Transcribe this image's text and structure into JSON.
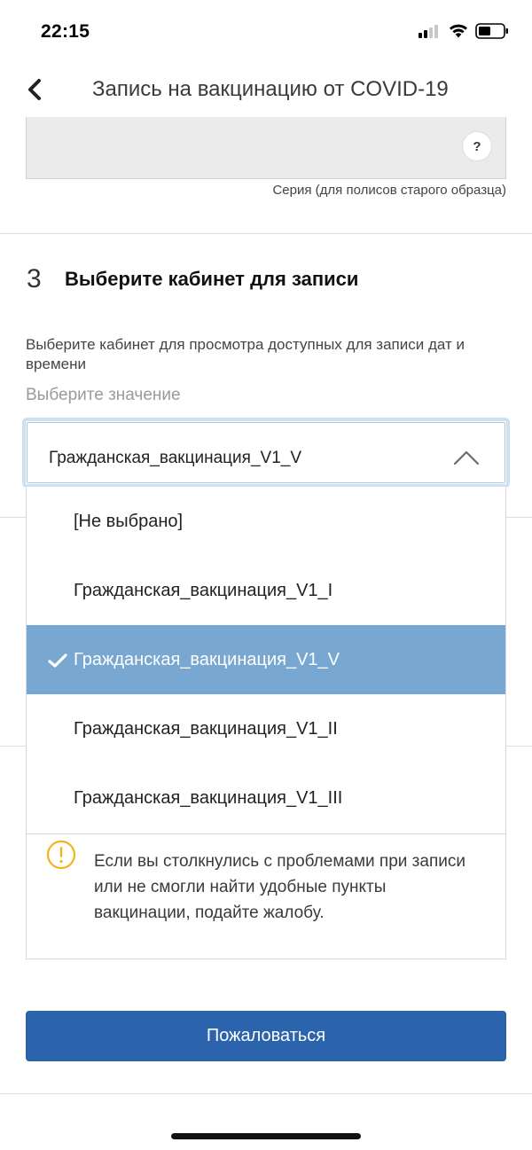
{
  "status_bar": {
    "time": "22:15",
    "icons": [
      "signal-icon",
      "wifi-icon",
      "battery-icon"
    ]
  },
  "header": {
    "back_icon": "chevron-left-icon",
    "title": "Запись на вакцинацию от COVID-19"
  },
  "series_field": {
    "value": "",
    "help_label": "?",
    "caption": "Серия (для полисов старого образца)"
  },
  "step3": {
    "number": "3",
    "title": "Выберите кабинет для записи",
    "description": "Выберите кабинет для просмотра доступных для записи дат и времени",
    "placeholder": "Выберите значение",
    "selected_value": "Гражданская_вакцинация_V1_V",
    "chevron_icon": "chevron-up-icon",
    "options": [
      {
        "label": "[Не выбрано]",
        "selected": false
      },
      {
        "label": "Гражданская_вакцинация_V1_I",
        "selected": false
      },
      {
        "label": "Гражданская_вакцинация_V1_V",
        "selected": true
      },
      {
        "label": "Гражданская_вакцинация_V1_II",
        "selected": false
      },
      {
        "label": "Гражданская_вакцинация_V1_III",
        "selected": false
      }
    ]
  },
  "info": {
    "icon": "warning-icon",
    "text": "Если вы столкнулись с проблемами при записи или не смогли найти удобные пункты вакцинации, подайте жалобу."
  },
  "complain_button": {
    "label": "Пожаловаться"
  },
  "colors": {
    "accent": "#2b63ac",
    "selected_option": "#78a8d1",
    "warning": "#f2b41c",
    "focus_ring": "#cfe1f1"
  }
}
